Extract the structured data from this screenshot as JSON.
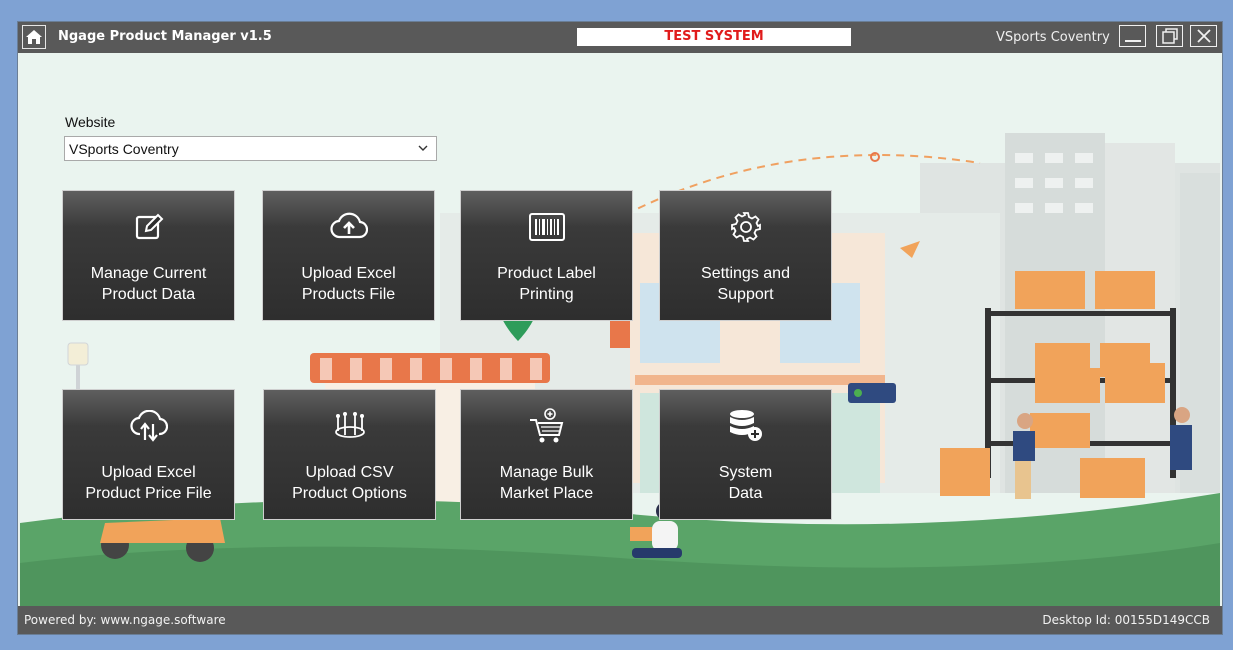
{
  "window": {
    "title": "Ngage Product Manager v1.5",
    "banner": "TEST SYSTEM",
    "site": "VSports Coventry"
  },
  "form": {
    "website_label": "Website",
    "website_value": "VSports Coventry"
  },
  "tiles": [
    {
      "label_1": "Manage Current",
      "label_2": "Product Data",
      "icon": "edit-icon"
    },
    {
      "label_1": "Upload Excel",
      "label_2": "Products File",
      "icon": "cloud-upload-icon"
    },
    {
      "label_1": "Product Label",
      "label_2": "Printing",
      "icon": "barcode-icon"
    },
    {
      "label_1": "Settings and",
      "label_2": "Support",
      "icon": "gear-icon"
    },
    {
      "label_1": "Upload Excel",
      "label_2": "Product Price File",
      "icon": "cloud-sync-icon"
    },
    {
      "label_1": "Upload CSV",
      "label_2": "Product Options",
      "icon": "options-icon"
    },
    {
      "label_1": "Manage Bulk",
      "label_2": "Market Place",
      "icon": "cart-add-icon"
    },
    {
      "label_1": "System",
      "label_2": "Data",
      "icon": "database-add-icon"
    }
  ],
  "status": {
    "powered_by": "Powered by: www.ngage.software",
    "desktop_id": "Desktop Id: 00155D149CCB"
  },
  "colors": {
    "titlebar": "#595959",
    "banner_text": "#e01b1b",
    "tile": "#2e2e2e",
    "ground": "#5aa468"
  }
}
